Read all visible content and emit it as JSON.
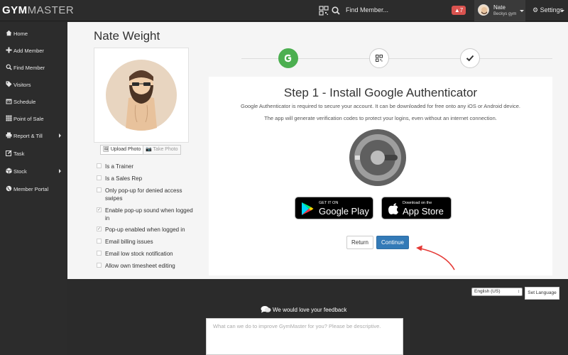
{
  "header": {
    "logo_gym": "GYM",
    "logo_master": "MASTER",
    "find_member": "Find Member...",
    "alert_count": "7",
    "user_name": "Nate",
    "user_gym": "Beckys gym",
    "settings": "Settings",
    "icons": [
      "qrcode-icon",
      "search-icon",
      "bell-icon",
      "gear-icon"
    ]
  },
  "sidebar": {
    "items": [
      {
        "label": "Home",
        "icon": "home-icon"
      },
      {
        "label": "Add Member",
        "icon": "plus-icon"
      },
      {
        "label": "Find Member",
        "icon": "search-icon"
      },
      {
        "label": "Visitors",
        "icon": "tag-icon"
      },
      {
        "label": "Schedule",
        "icon": "calendar-icon"
      },
      {
        "label": "Point of Sale",
        "icon": "grid-icon"
      },
      {
        "label": "Report & Till",
        "icon": "printer-icon"
      },
      {
        "label": "Task",
        "icon": "edit-icon"
      },
      {
        "label": "Stock",
        "icon": "box-icon"
      },
      {
        "label": "Member Portal",
        "icon": "globe-icon"
      }
    ]
  },
  "member": {
    "name": "Nate Weight",
    "upload_photo": "Upload Photo",
    "take_photo": "Take Photo",
    "options": [
      {
        "label": "Is a Trainer",
        "checked": false
      },
      {
        "label": "Is a Sales Rep",
        "checked": false
      },
      {
        "label": "Only pop-up for denied access swipes",
        "checked": false
      },
      {
        "label": "Enable pop-up sound when logged in",
        "checked": true
      },
      {
        "label": "Pop-up enabled when logged in",
        "checked": true
      },
      {
        "label": "Email billing issues",
        "checked": false
      },
      {
        "label": "Email low stock notification",
        "checked": false
      },
      {
        "label": "Allow own timesheet editing",
        "checked": false
      }
    ]
  },
  "step": {
    "title": "Step 1 - Install Google Authenticator",
    "desc1": "Google Authenticator is required to secure your account. It can be downloaded for free onto any iOS or Android device.",
    "desc2": "The app will generate verification codes to protect your logins, even without an internet connection.",
    "google_play_small": "GET IT ON",
    "google_play_big": "Google Play",
    "app_store_small": "Download on the",
    "app_store_big": "App Store",
    "return_label": "Return",
    "continue_label": "Continue",
    "accent_color": "#4caf50",
    "primary_color": "#337ab7"
  },
  "footer": {
    "language": "English (US)",
    "set_language": "Set Language",
    "feedback_title": "We would love your feedback",
    "feedback_placeholder": "What can we do to improve GymMaster for you? Please be descriptive."
  }
}
